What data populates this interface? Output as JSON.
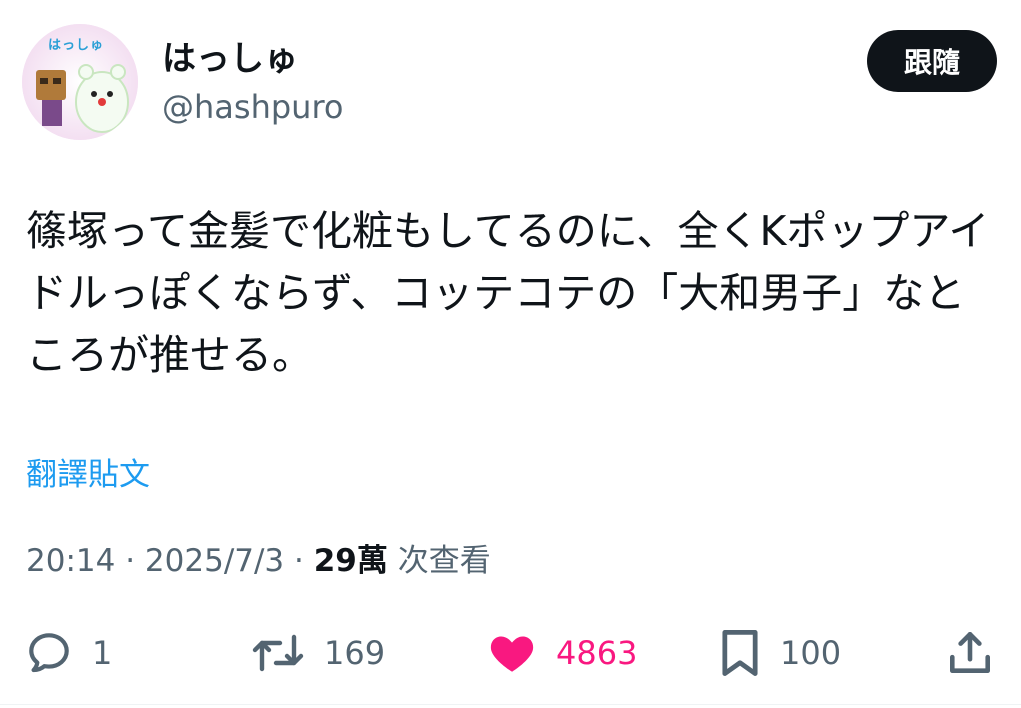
{
  "author": {
    "display_name": "はっしゅ",
    "handle": "@hashpuro",
    "avatar_label": "はっしゅ"
  },
  "follow_button": {
    "label": "跟隨"
  },
  "tweet": {
    "text": "篠塚って金髪で化粧もしてるのに、全くKポップアイドルっぽくならず、コッテコテの「大和男子」なところが推せる。",
    "translate_label": "翻譯貼文",
    "time": "20:14",
    "separator": "·",
    "date": "2025/7/3",
    "views_count": "29萬",
    "views_label": "次查看"
  },
  "actions": {
    "reply": {
      "icon": "reply-icon",
      "count": "1"
    },
    "retweet": {
      "icon": "retweet-icon",
      "count": "169"
    },
    "like": {
      "icon": "heart-icon",
      "count": "4863",
      "active": true,
      "color": "#f91880"
    },
    "bookmark": {
      "icon": "bookmark-icon",
      "count": "100"
    },
    "share": {
      "icon": "share-icon"
    }
  },
  "colors": {
    "text": "#0f1419",
    "secondary": "#536471",
    "link": "#1d9bf0",
    "like": "#f91880",
    "button_bg": "#0f1419"
  }
}
